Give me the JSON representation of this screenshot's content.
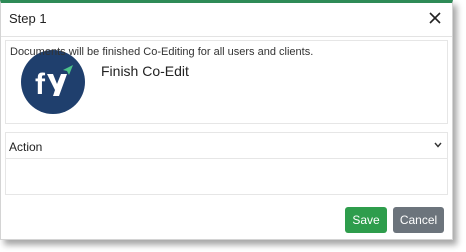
{
  "dialog": {
    "title": "Step 1",
    "step_name": "Finish Co-Edit",
    "logo": {
      "text": "fy",
      "icon": "paper-plane-icon",
      "background": "#1f3f6d",
      "accent": "#4cc38a"
    }
  },
  "action": {
    "header": "Action",
    "description": "Documents will be finished Co-Editing for all users and clients."
  },
  "buttons": {
    "save": "Save",
    "cancel": "Cancel"
  },
  "colors": {
    "accent": "#2e8b57",
    "save": "#2e9d4c",
    "cancel": "#6c747c"
  }
}
